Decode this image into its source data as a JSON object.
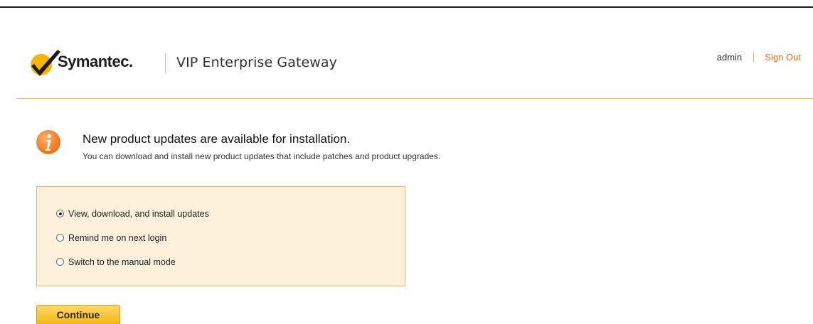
{
  "header": {
    "brand": "Symantec.",
    "product": "VIP Enterprise Gateway",
    "user": "admin",
    "sign_out": "Sign Out"
  },
  "notice": {
    "icon": "info-icon",
    "title": "New product updates are available for installation.",
    "text": "You can download and install new product updates that include patches and product upgrades."
  },
  "options": [
    {
      "label": "View, download, and install updates",
      "checked": true
    },
    {
      "label": "Remind me on next login",
      "checked": false
    },
    {
      "label": "Switch to the manual mode",
      "checked": false
    }
  ],
  "continue_label": "Continue",
  "colors": {
    "accent_orange": "#d96f1a",
    "rule_gold": "#f0b73e",
    "panel_bg": "#fdf1dc",
    "panel_border": "#e7b46f",
    "button_yellow": "#f5b614",
    "logo_check": "#f7b500"
  }
}
